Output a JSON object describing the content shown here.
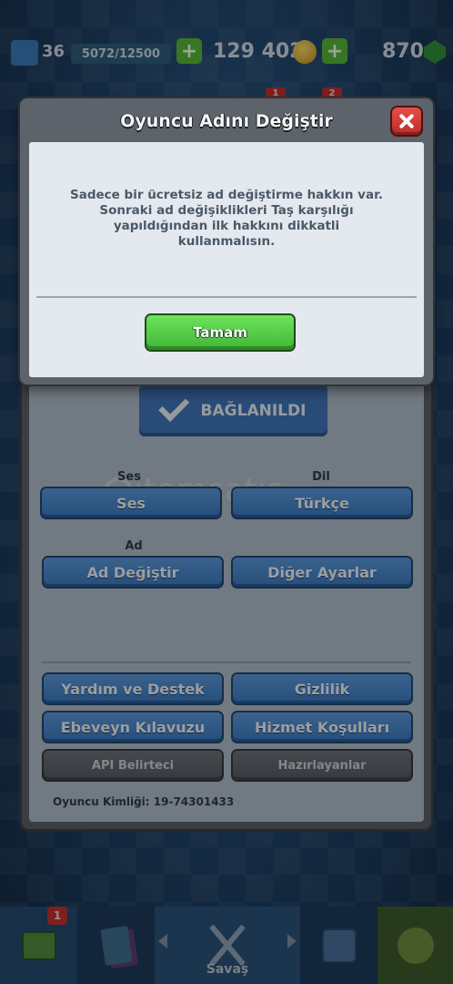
{
  "topbar": {
    "level": "36",
    "xp": "5072/12500",
    "gold": "129 402",
    "gems": "870",
    "plus_label": "+",
    "notif_1": "1",
    "notif_2": "2"
  },
  "dialog": {
    "title": "Oyuncu Adını Değiştir",
    "message": "Sadece bir ücretsiz ad değiştirme hakkın var. Sonraki ad değişiklikleri Taş karşılığı yapıldığından ilk hakkını dikkatli kullanmalısın.",
    "ok_label": "Tamam",
    "close_icon": "close-icon"
  },
  "settings": {
    "connected_label": "BAĞLANILDI",
    "sound_section": "Ses",
    "sound_button": "Ses",
    "language_section": "Dil",
    "language_button": "Türkçe",
    "name_section": "Ad",
    "change_name_button": "Ad Değiştir",
    "other_settings_button": "Diğer Ayarlar",
    "help_button": "Yardım ve Destek",
    "privacy_button": "Gizlilik",
    "parent_guide_button": "Ebeveyn Kılavuzu",
    "terms_button": "Hizmet Koşulları",
    "api_button": "API Belirteci",
    "credits_button": "Hazırlayanlar",
    "player_id": "Oyuncu Kimliği: 19-74301433",
    "watermark": "itemsatış"
  },
  "bottom_nav": {
    "battle_label": "Savaş",
    "shop_badge": "1"
  },
  "colors": {
    "ok_green": "#4fc642",
    "close_red": "#d4433e",
    "button_blue": "#4a88cc"
  }
}
